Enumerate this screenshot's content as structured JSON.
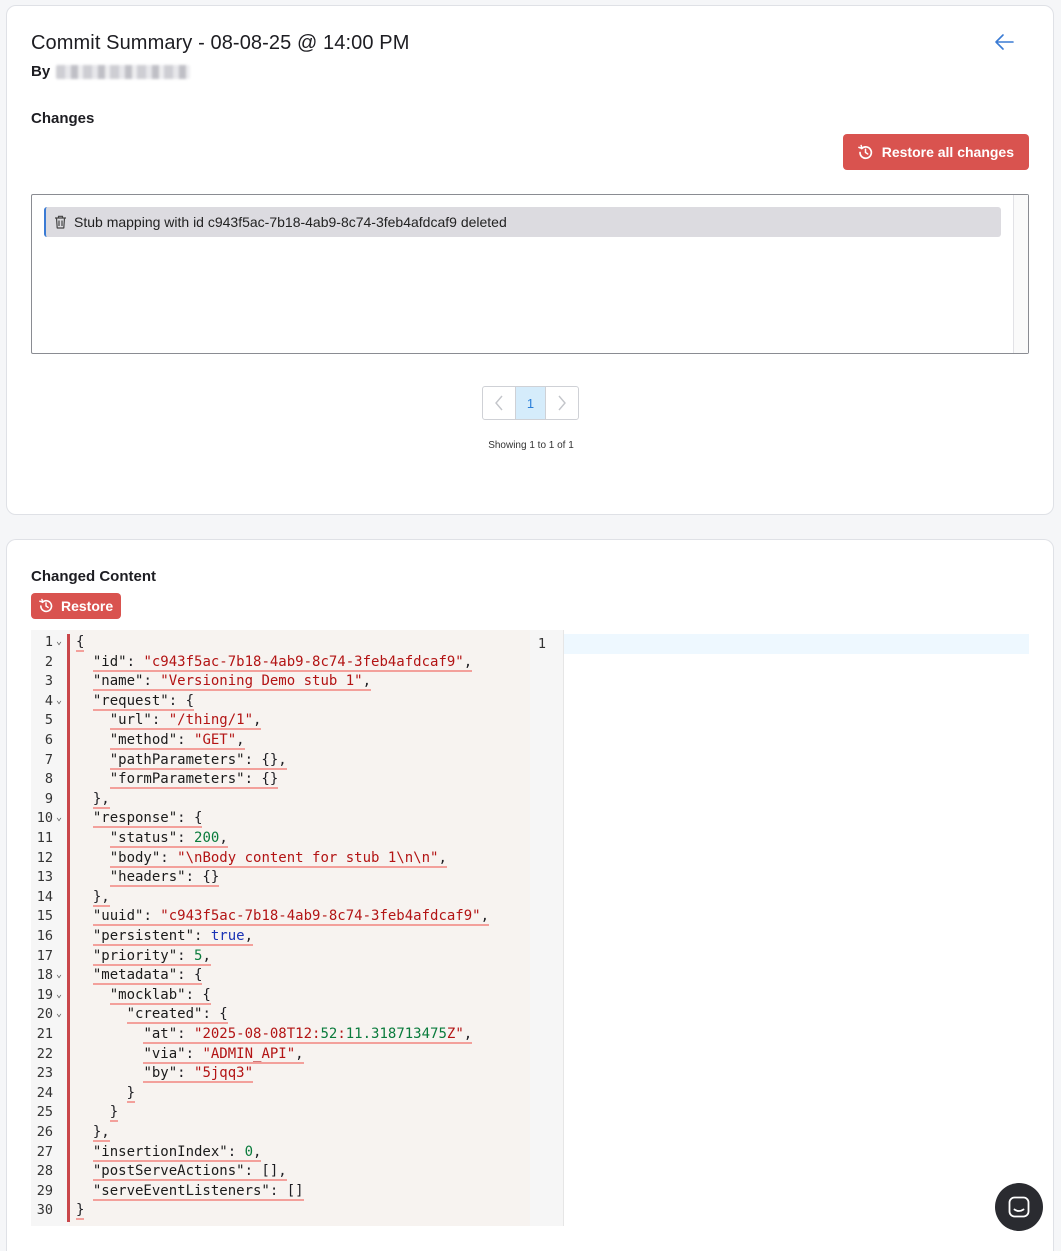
{
  "header": {
    "title": "Commit Summary - 08-08-25 @ 14:00 PM",
    "by_label": "By"
  },
  "changes": {
    "label": "Changes",
    "restore_all_label": "Restore all changes",
    "items": [
      {
        "text": "Stub mapping with id c943f5ac-7b18-4ab9-8c74-3feb4afdcaf9 deleted",
        "icon": "trash-icon"
      }
    ],
    "pagination": {
      "current_page": "1",
      "showing_text": "Showing 1 to 1 of 1"
    }
  },
  "changed_content": {
    "label": "Changed Content",
    "restore_label": "Restore",
    "left_lines": [
      "{",
      "  \"id\": \"c943f5ac-7b18-4ab9-8c74-3feb4afdcaf9\",",
      "  \"name\": \"Versioning Demo stub 1\",",
      "  \"request\": {",
      "    \"url\": \"/thing/1\",",
      "    \"method\": \"GET\",",
      "    \"pathParameters\": {},",
      "    \"formParameters\": {}",
      "  },",
      "  \"response\": {",
      "    \"status\": 200,",
      "    \"body\": \"\\nBody content for stub 1\\n\\n\",",
      "    \"headers\": {}",
      "  },",
      "  \"uuid\": \"c943f5ac-7b18-4ab9-8c74-3feb4afdcaf9\",",
      "  \"persistent\": true,",
      "  \"priority\": 5,",
      "  \"metadata\": {",
      "    \"mocklab\": {",
      "      \"created\": {",
      "        \"at\": \"2025-08-08T12:52:11.318713475Z\",",
      "        \"via\": \"ADMIN_API\",",
      "        \"by\": \"5jqq3\"",
      "      }",
      "    }",
      "  },",
      "  \"insertionIndex\": 0,",
      "  \"postServeActions\": [],",
      "  \"serveEventListeners\": []",
      "}"
    ],
    "fold_lines": [
      1,
      4,
      10,
      18,
      19,
      20
    ],
    "right_lines": [
      ""
    ]
  },
  "colors": {
    "accent_red": "#d9534f",
    "link_blue": "#3b7bd4",
    "diff_removed_underline": "#f3a09b",
    "json_string": "#b31414",
    "json_number": "#0a7b3c",
    "json_boolean": "#1932b5"
  }
}
